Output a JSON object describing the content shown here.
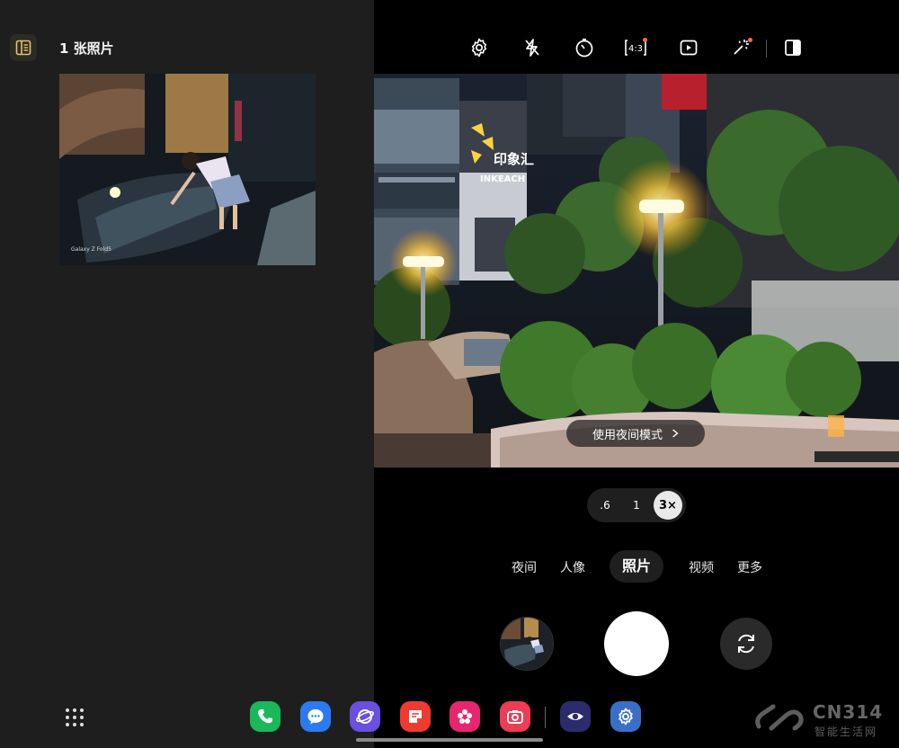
{
  "gallery": {
    "count_label": "1 张照片",
    "thumbnail_caption": "Galaxy Z Fold5"
  },
  "camera": {
    "toolbar_icons": [
      "settings-icon",
      "flash-off-icon",
      "timer-icon",
      "aspect-ratio-icon",
      "motion-photo-icon",
      "filter-effects-icon",
      "split-view-icon"
    ],
    "aspect_label": "4:3",
    "night_hint": "使用夜间模式",
    "zoom": {
      "options": [
        ".6",
        "1",
        "3×"
      ],
      "selected": "3×"
    },
    "modes": [
      {
        "label": "夜间"
      },
      {
        "label": "人像"
      },
      {
        "label": "照片",
        "active": true
      },
      {
        "label": "视频"
      },
      {
        "label": "更多"
      }
    ]
  },
  "viewfinder": {
    "signs": {
      "sign_a": "印象汇",
      "sign_b": "INKEACH"
    }
  },
  "taskbar": {
    "apps": [
      "phone-icon",
      "messages-icon",
      "internet-icon",
      "notes-icon",
      "flower-icon",
      "camera-icon",
      "eye-icon",
      "settings-icon"
    ]
  },
  "watermark": {
    "title": "CN314",
    "subtitle": "智能生活网"
  },
  "colors": {
    "accent_dot": "#ff6a3d",
    "panel_bg": "#1e1e1e"
  }
}
